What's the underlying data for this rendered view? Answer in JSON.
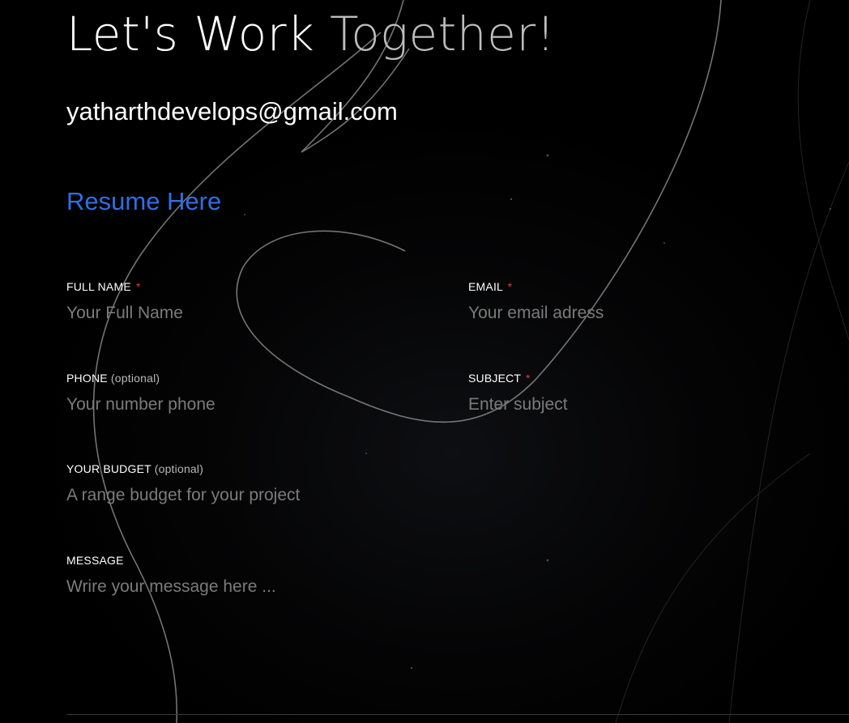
{
  "header": {
    "title_part1": "Let's Work",
    "title_part2": "Together!"
  },
  "contact": {
    "email": "yatharthdevelops@gmail.com",
    "resume_label": "Resume Here"
  },
  "form": {
    "full_name": {
      "label": "FULL NAME",
      "required_mark": "*",
      "placeholder": "Your Full Name"
    },
    "email": {
      "label": "EMAIL",
      "required_mark": "*",
      "placeholder": "Your email adress"
    },
    "phone": {
      "label": "PHONE",
      "optional_note": "(optional)",
      "placeholder": "Your number phone"
    },
    "subject": {
      "label": "SUBJECT",
      "required_mark": "*",
      "placeholder": "Enter subject"
    },
    "budget": {
      "label": "YOUR BUDGET",
      "optional_note": "(optional)",
      "placeholder": "A range budget for your project"
    },
    "message": {
      "label": "MESSAGE",
      "placeholder": "Wrire your message here ..."
    }
  },
  "colors": {
    "background": "#000000",
    "heading_primary": "#ffffff",
    "heading_secondary": "#bdbdbd",
    "link_accent": "#2f6fe0",
    "required_mark": "#e53935",
    "placeholder": "#7b7b7b"
  }
}
